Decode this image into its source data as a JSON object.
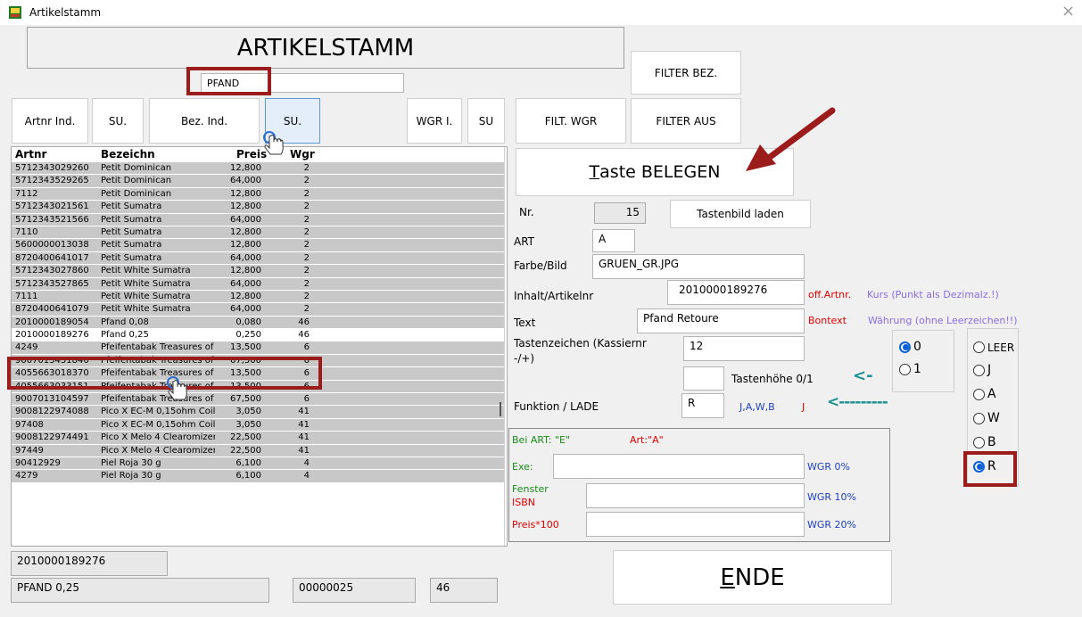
{
  "window": {
    "title": "Artikelstamm",
    "close": "×"
  },
  "header": {
    "title": "ARTIKELSTAMM"
  },
  "search": {
    "value": "PFAND"
  },
  "buttons": {
    "artnr_ind": "Artnr Ind.",
    "su1": "SU.",
    "bez_ind": "Bez. Ind.",
    "su2": "SU.",
    "wgr_i": "WGR I.",
    "su3": "SU",
    "filt_wgr": "FILT. WGR",
    "filter_aus": "FILTER AUS",
    "filter_bez": "FILTER BEZ.",
    "taste_belegen_first": "T",
    "taste_belegen_rest": "aste BELEGEN",
    "tastenbild_laden": "Tastenbild laden",
    "ende_first": "E",
    "ende_rest": "NDE"
  },
  "grid": {
    "columns": [
      "Artnr",
      "Bezeichn",
      "Preis",
      "Wgr"
    ],
    "rows": [
      [
        "5712343029260",
        "Petit Dominican",
        "12,800",
        "2"
      ],
      [
        "5712343529265",
        "Petit Dominican",
        "64,000",
        "2"
      ],
      [
        "7112",
        "Petit Dominican",
        "12,800",
        "2"
      ],
      [
        "5712343021561",
        "Petit Sumatra",
        "12,800",
        "2"
      ],
      [
        "5712343521566",
        "Petit Sumatra",
        "64,000",
        "2"
      ],
      [
        "7110",
        "Petit Sumatra",
        "12,800",
        "2"
      ],
      [
        "5600000013038",
        "Petit Sumatra",
        "12,800",
        "2"
      ],
      [
        "8720400641017",
        "Petit Sumatra",
        "64,000",
        "2"
      ],
      [
        "5712343027860",
        "Petit White Sumatra",
        "12,800",
        "2"
      ],
      [
        "5712343527865",
        "Petit White Sumatra",
        "64,000",
        "2"
      ],
      [
        "7111",
        "Petit White Sumatra",
        "12,800",
        "2"
      ],
      [
        "8720400641079",
        "Petit White Sumatra",
        "64,000",
        "2"
      ],
      [
        "2010000189054",
        "Pfand 0,08",
        "0,080",
        "46"
      ],
      [
        "2010000189276",
        "Pfand 0,25",
        "0,250",
        "46"
      ],
      [
        "4249",
        "Pfeifentabak Treasures of",
        "13,500",
        "6"
      ],
      [
        "9007013431846",
        "Pfeifentabak Treasures of",
        "67,500",
        "6"
      ],
      [
        "4055663018370",
        "Pfeifentabak Treasures of",
        "13,500",
        "6"
      ],
      [
        "4055663033151",
        "Pfeifentabak Treasures of",
        "13,500",
        "6"
      ],
      [
        "9007013104597",
        "Pfeifentabak Treasures of",
        "67,500",
        "6"
      ],
      [
        "9008122974088",
        "Pico X EC-M 0,15ohm Coil",
        "3,050",
        "41"
      ],
      [
        "97408",
        "Pico X EC-M 0,15ohm Coil",
        "3,050",
        "41"
      ],
      [
        "9008122974491",
        "Pico X Melo 4 Clearomizer",
        "22,500",
        "41"
      ],
      [
        "97449",
        "Pico X Melo 4 Clearomizer",
        "22,500",
        "41"
      ],
      [
        "90412929",
        "Piel Roja 30 g",
        "6,100",
        "4"
      ],
      [
        "4279",
        "Piel Roja 30 g",
        "6,100",
        "4"
      ]
    ],
    "selected_index": 13
  },
  "bottom": {
    "artnr": "2010000189276",
    "name": "PFAND 0,25",
    "code": "00000025",
    "wgr": "46"
  },
  "form": {
    "nr_label": "Nr.",
    "nr_value": "15",
    "art_label": "ART",
    "art_value": "A",
    "farbe_label": "Farbe/Bild",
    "farbe_value": "GRUEN_GR.JPG",
    "inhalt_label": "Inhalt/Artikelnr",
    "inhalt_value": "2010000189276",
    "off_artnr": "off.Artnr.",
    "kurs": "Kurs (Punkt als Dezimalz.!)",
    "text_label": "Text",
    "text_value": "Pfand Retoure",
    "bontext": "Bontext",
    "waehrung": "Währung (ohne Leerzeichen!!)",
    "tastenzeichen_label": "Tastenzeichen (Kassiernr -/+)",
    "tastenzeichen_value": "12",
    "tastenhoehe_label": "Tastenhöhe 0/1",
    "tastenhoehe_value": "",
    "arrow1": "<-",
    "funktion_label": "Funktion / LADE",
    "funktion_value": "R",
    "jawb": "J,A,W,B",
    "j": "J",
    "arrow2": "<---------"
  },
  "lower_box": {
    "bei_art": "Bei ART: \"E\"",
    "art_a": "Art:\"A\"",
    "exe_label": "Exe:",
    "exe_value": "",
    "fenster_label": "Fenster",
    "isbn_label": "ISBN",
    "fenster_value": "",
    "preis_label": "Preis*100",
    "preis_value": "",
    "wgr0": "WGR 0%",
    "wgr10": "WGR 10%",
    "wgr20": "WGR 20%"
  },
  "radios_height": [
    {
      "label": "0",
      "checked": true
    },
    {
      "label": "1",
      "checked": false
    }
  ],
  "radios_func": [
    {
      "label": "LEER",
      "checked": false
    },
    {
      "label": "J",
      "checked": false
    },
    {
      "label": "A",
      "checked": false
    },
    {
      "label": "W",
      "checked": false
    },
    {
      "label": "B",
      "checked": false
    },
    {
      "label": "R",
      "checked": true
    }
  ],
  "colors": {
    "highlight": "#9c1b1b",
    "accent_blue": "#0a5fd6",
    "red": "#e00000",
    "purple": "#8a6de6"
  }
}
